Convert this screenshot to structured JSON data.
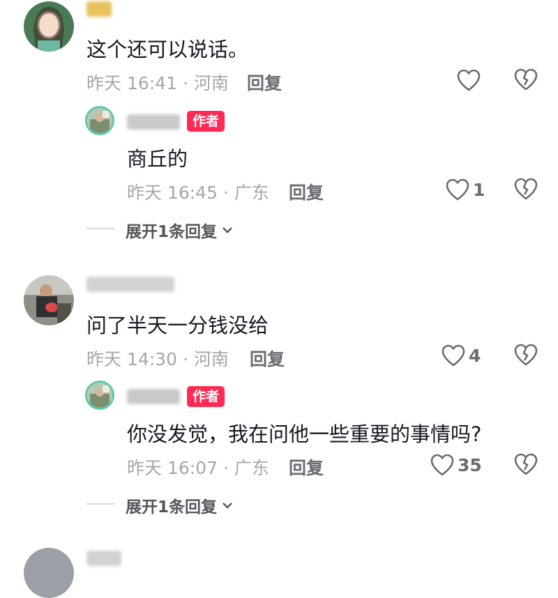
{
  "comments": [
    {
      "text": "这个还可以说话。",
      "meta": "昨天 16:41 · 河南",
      "reply_label": "回复",
      "likes": "",
      "reply": {
        "badge": "作者",
        "text": "商丘的",
        "meta": "昨天 16:45 · 广东",
        "reply_label": "回复",
        "likes": "1"
      },
      "expand_label": "展开1条回复"
    },
    {
      "text": "问了半天一分钱没给",
      "meta": "昨天 14:30 · 河南",
      "reply_label": "回复",
      "likes": "4",
      "reply": {
        "badge": "作者",
        "text": "你没发觉，我在问他一些重要的事情吗?",
        "meta": "昨天 16:07 · 广东",
        "reply_label": "回复",
        "likes": "35"
      },
      "expand_label": "展开1条回复"
    }
  ],
  "colors": {
    "accent": "#fe2c55",
    "meta": "#a6a7ab",
    "text": "#161823"
  },
  "icons": [
    "heart-icon",
    "dislike-broken-heart-icon",
    "chevron-down-icon"
  ]
}
